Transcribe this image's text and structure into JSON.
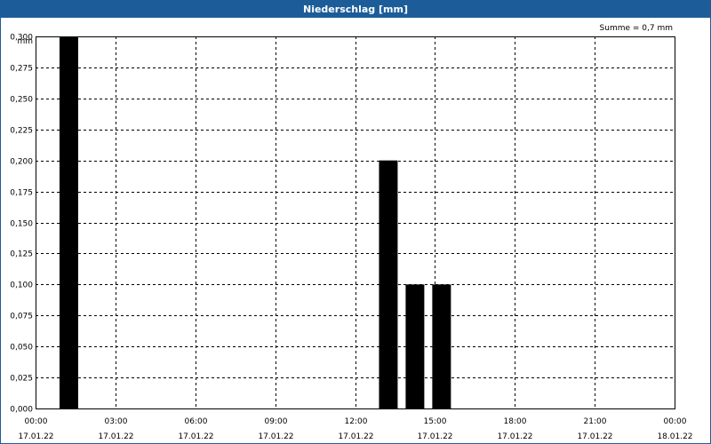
{
  "window": {
    "title": "Niederschlag [mm]"
  },
  "colors": {
    "titlebar": "#1c5d99",
    "bar": "#000000",
    "grid": "#000000"
  },
  "chart_data": {
    "type": "bar",
    "title": "Niederschlag [mm]",
    "ylabel": "mm",
    "xlabel": "",
    "summary": "Summe = 0,7 mm",
    "ylim": [
      0,
      0.3
    ],
    "yticks": [
      {
        "value": 0.0,
        "label": "0,000"
      },
      {
        "value": 0.025,
        "label": "0,025"
      },
      {
        "value": 0.05,
        "label": "0,050"
      },
      {
        "value": 0.075,
        "label": "0,075"
      },
      {
        "value": 0.1,
        "label": "0,100"
      },
      {
        "value": 0.125,
        "label": "0,125"
      },
      {
        "value": 0.15,
        "label": "0,150"
      },
      {
        "value": 0.175,
        "label": "0,175"
      },
      {
        "value": 0.2,
        "label": "0,200"
      },
      {
        "value": 0.225,
        "label": "0,225"
      },
      {
        "value": 0.25,
        "label": "0,250"
      },
      {
        "value": 0.275,
        "label": "0,275"
      },
      {
        "value": 0.3,
        "label": "0,300"
      }
    ],
    "xlim": [
      "17.01.22 00:00",
      "18.01.22 00:00"
    ],
    "xticks": [
      {
        "time": "00:00",
        "date": "17.01.22"
      },
      {
        "time": "03:00",
        "date": "17.01.22"
      },
      {
        "time": "06:00",
        "date": "17.01.22"
      },
      {
        "time": "09:00",
        "date": "17.01.22"
      },
      {
        "time": "12:00",
        "date": "17.01.22"
      },
      {
        "time": "15:00",
        "date": "17.01.22"
      },
      {
        "time": "18:00",
        "date": "17.01.22"
      },
      {
        "time": "21:00",
        "date": "17.01.22"
      },
      {
        "time": "00:00",
        "date": "18.01.22"
      }
    ],
    "grid": true,
    "bars": [
      {
        "time": "01:00",
        "value": 0.3
      },
      {
        "time": "13:00",
        "value": 0.2
      },
      {
        "time": "14:00",
        "value": 0.1
      },
      {
        "time": "15:00",
        "value": 0.1
      }
    ]
  }
}
